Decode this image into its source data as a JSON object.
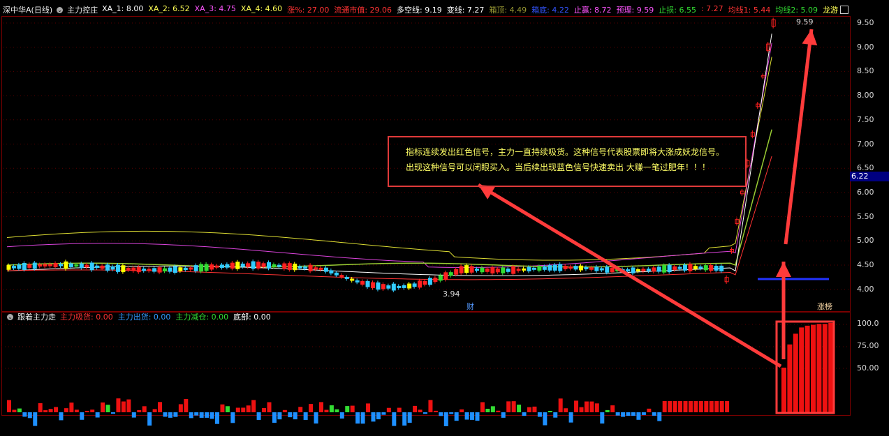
{
  "upper_header": {
    "stock_name": "深中华A(日线)",
    "indicator_name": "主力控庄",
    "items": [
      {
        "label": "XA_1: 8.00",
        "color": "#ffffff"
      },
      {
        "label": "XA_2: 6.52",
        "color": "#ffff55"
      },
      {
        "label": "XA_3: 4.75",
        "color": "#ff55ff"
      },
      {
        "label": "XA_4: 4.60",
        "color": "#ffff55"
      },
      {
        "label": "涨%: 27.00",
        "color": "#ff3333"
      },
      {
        "label": "流通市值: 29.06",
        "color": "#ff3333"
      },
      {
        "label": "多空线: 9.19",
        "color": "#ffffff"
      },
      {
        "label": "变线: 7.27",
        "color": "#ffffff"
      },
      {
        "label": "箱顶: 4.49",
        "color": "#999933"
      },
      {
        "label": "箱底: 4.22",
        "color": "#3355ff"
      },
      {
        "label": "止赢: 8.72",
        "color": "#ff55ff"
      },
      {
        "label": "预理: 9.59",
        "color": "#ff55ff"
      },
      {
        "label": "止损: 6.55",
        "color": "#33dd33"
      },
      {
        "label": ": 7.27",
        "color": "#ff3333"
      },
      {
        "label": "均线1: 5.44",
        "color": "#ff3333"
      },
      {
        "label": "均线2: 5.09",
        "color": "#33dd33"
      },
      {
        "label": "龙游",
        "color": "#ffff55"
      }
    ]
  },
  "lower_header": {
    "indicator_name": "跟着主力走",
    "items": [
      {
        "label": "主力吸货: 0.00",
        "color": "#ff3333"
      },
      {
        "label": "主力出货: 0.00",
        "color": "#3399ff"
      },
      {
        "label": "主力减仓: 0.00",
        "color": "#33dd33"
      },
      {
        "label": "底部: 0.00",
        "color": "#ffffff"
      }
    ]
  },
  "annotation": {
    "line1": "指标连续发出红色信号，主力一直持续吸货。这种信号代表股票即将大涨成妖龙信号。",
    "line2": "出现这种信号可以闭眼买入。当后续出现蓝色信号快速卖出 大赚一笔过肥年！！！"
  },
  "price_axis": [
    "9.50",
    "9.00",
    "8.50",
    "8.00",
    "7.50",
    "7.00",
    "6.50",
    "6.00",
    "5.50",
    "5.00",
    "4.50",
    "4.00"
  ],
  "current_price_tag": "6.22",
  "high_label": "9.59",
  "low_label": "3.94",
  "event_labels": {
    "cai": "财",
    "zhangting": "涨榜"
  },
  "volume_axis": [
    "100.0",
    "75.00",
    "50.00"
  ],
  "chart_data": {
    "type": "bar",
    "title": "跟着主力走",
    "ylim": [
      0,
      100
    ],
    "final_signal_values": [
      50,
      76,
      88,
      95,
      97,
      98,
      99,
      99,
      100
    ]
  },
  "colors": {
    "up": "#ff2020",
    "down": "#33ccff",
    "flat": "#ffff00",
    "grid": "#7a0000"
  }
}
